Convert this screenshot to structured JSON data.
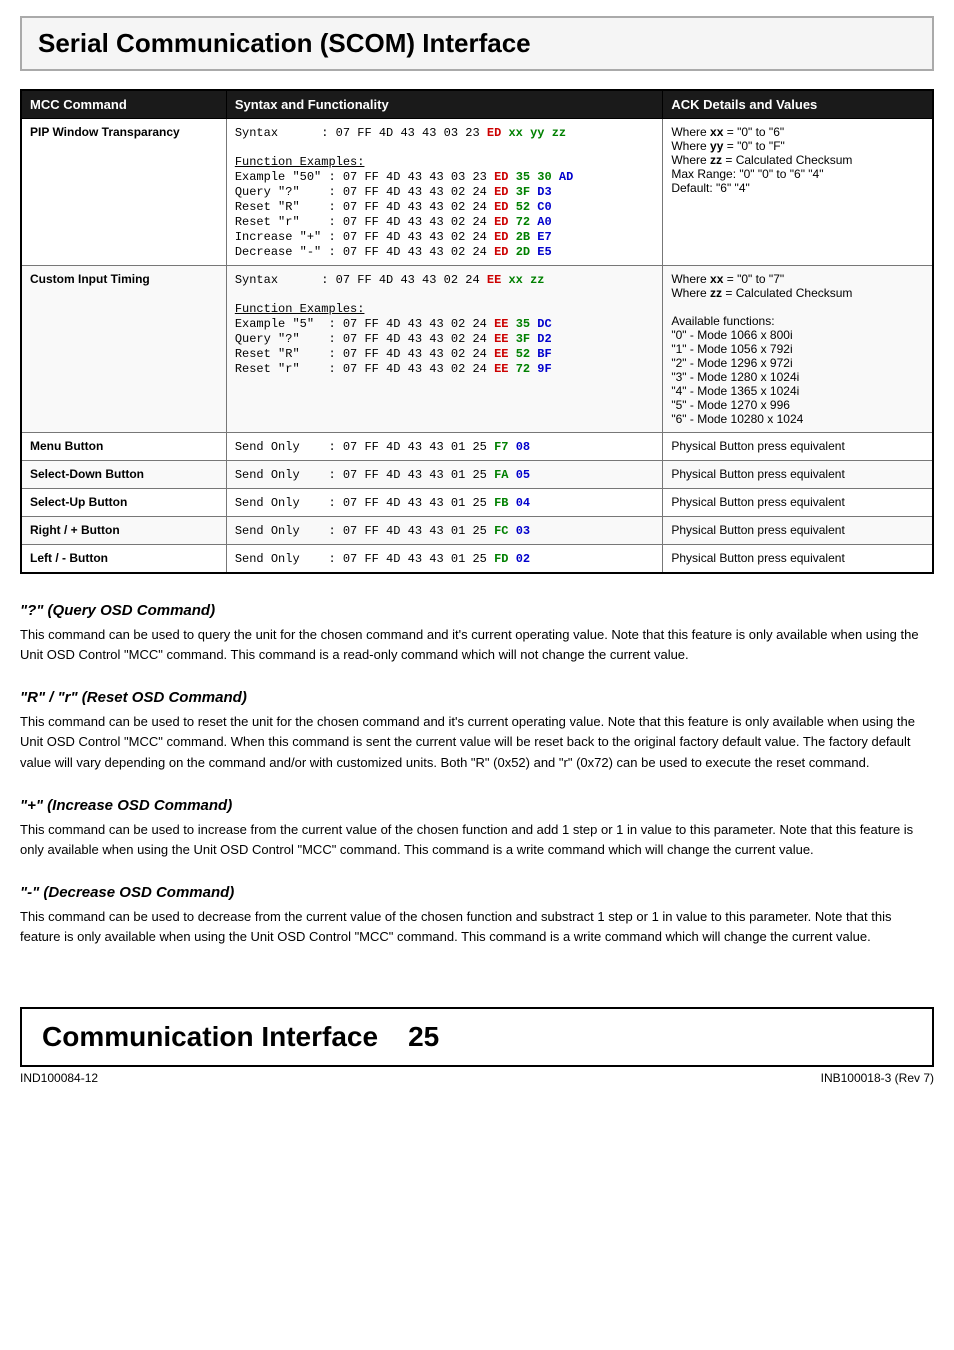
{
  "page": {
    "title": "Serial Communication (SCOM) Interface"
  },
  "table": {
    "headers": [
      "MCC Command",
      "Syntax and Functionality",
      "ACK Details and Values"
    ],
    "rows": [
      {
        "id": "pip-window",
        "label": "PIP Window Transparancy",
        "syntax_lines": [
          {
            "text": "Syntax      : 07 FF 4D 43 43 03 23 ED xx yy zz"
          },
          {
            "text": ""
          },
          {
            "text": "Function Examples:"
          },
          {
            "text": "Example \"50\" : 07 FF 4D 43 43 03 23 ED 35 30 AD"
          },
          {
            "text": "Query \"?\"    : 07 FF 4D 43 43 02 24 ED 3F D3"
          },
          {
            "text": "Reset \"R\"    : 07 FF 4D 43 43 02 24 ED 52 C0"
          },
          {
            "text": "Reset \"r\"    : 07 FF 4D 43 43 02 24 ED 72 A0"
          },
          {
            "text": "Increase \"+\" : 07 FF 4D 43 43 02 24 ED 2B E7"
          },
          {
            "text": "Decrease \"-\" : 07 FF 4D 43 43 02 24 ED 2D E5"
          }
        ],
        "ack_lines": [
          "Where xx = \"0\" to \"6\"",
          "Where yy = \"0\" to \"F\"",
          "Where zz = Calculated Checksum",
          "Max Range: \"0\" \"0\" to \"6\" \"4\"",
          "Default: \"6\" \"4\""
        ]
      },
      {
        "id": "custom-input",
        "label": "Custom Input Timing",
        "syntax_lines": [
          {
            "text": "Syntax      : 07 FF 4D 43 43 02 24 EE xx zz"
          },
          {
            "text": ""
          },
          {
            "text": "Function Examples:"
          },
          {
            "text": "Example \"5\"  : 07 FF 4D 43 43 02 24 EE 35 DC"
          },
          {
            "text": "Query \"?\"    : 07 FF 4D 43 43 02 24 EE 3F D2"
          },
          {
            "text": "Reset \"R\"    : 07 FF 4D 43 43 02 24 EE 52 BF"
          },
          {
            "text": "Reset \"r\"    : 07 FF 4D 43 43 02 24 EE 72 9F"
          }
        ],
        "ack_lines": [
          "Where xx = \"0\" to \"7\"",
          "Where zz = Calculated Checksum",
          "",
          "Available functions:",
          "\"0\" - Mode 1066 x 800i",
          "\"1\" - Mode 1056 x 792i",
          "\"2\" - Mode 1296 x 972i",
          "\"3\" - Mode 1280 x 1024i",
          "\"4\" - Mode 1365 x 1024i",
          "\"5\" - Mode 1270 x 996",
          "\"6\" - Mode 10280 x 1024"
        ]
      },
      {
        "id": "menu-button",
        "label": "Menu Button",
        "syntax": "Send Only    : 07 FF 4D 43 43 01 25 F7 08",
        "ack": "Physical Button press equivalent"
      },
      {
        "id": "select-down",
        "label": "Select-Down Button",
        "syntax": "Send Only    : 07 FF 4D 43 43 01 25 FA 05",
        "ack": "Physical Button press equivalent"
      },
      {
        "id": "select-up",
        "label": "Select-Up Button",
        "syntax": "Send Only    : 07 FF 4D 43 43 01 25 FB 04",
        "ack": "Physical Button press equivalent"
      },
      {
        "id": "right-button",
        "label": "Right / + Button",
        "syntax": "Send Only    : 07 FF 4D 43 43 01 25 FC 03",
        "ack": "Physical Button press equivalent"
      },
      {
        "id": "left-button",
        "label": "Left / - Button",
        "syntax": "Send Only    : 07 FF 4D 43 43 01 25 FD 02",
        "ack": "Physical Button press equivalent"
      }
    ]
  },
  "sections": [
    {
      "id": "query",
      "title": "\"?\" (Query OSD Command)",
      "body": "This command can be used to query the unit for the chosen command and it's current operating value. Note that this feature is only available when using the Unit OSD Control \"MCC\" command. This command is a read-only command which will not change the current value."
    },
    {
      "id": "reset",
      "title": "\"R\" / \"r\" (Reset OSD Command)",
      "body": "This command can be used to reset the unit for the chosen command and it's current operating value. Note that this feature is only available when using the Unit OSD Control \"MCC\" command. When this command is sent the current value will be reset back to the original factory default value. The factory default value will vary depending on the command and/or with customized units. Both \"R\" (0x52) and \"r\" (0x72) can be used to execute the reset command."
    },
    {
      "id": "increase",
      "title": "\"+\" (Increase OSD Command)",
      "body": "This command can be used to increase from the current value of the chosen function and add 1 step or 1 in value to this parameter. Note that this feature is only available when using the Unit OSD Control \"MCC\" command. This command is a write command which will change the current value."
    },
    {
      "id": "decrease",
      "title": "\"-\" (Decrease OSD Command)",
      "body": "This command can be used to decrease from the current value of the chosen function and substract 1 step or 1 in value to this parameter. Note that this feature is only available when using the Unit OSD Control \"MCC\" command. This command is a write command which will change the current value."
    }
  ],
  "footer": {
    "title": "Communication Interface",
    "page_number": "25",
    "left_doc": "IND100084-12",
    "right_doc": "INB100018-3 (Rev 7)"
  }
}
